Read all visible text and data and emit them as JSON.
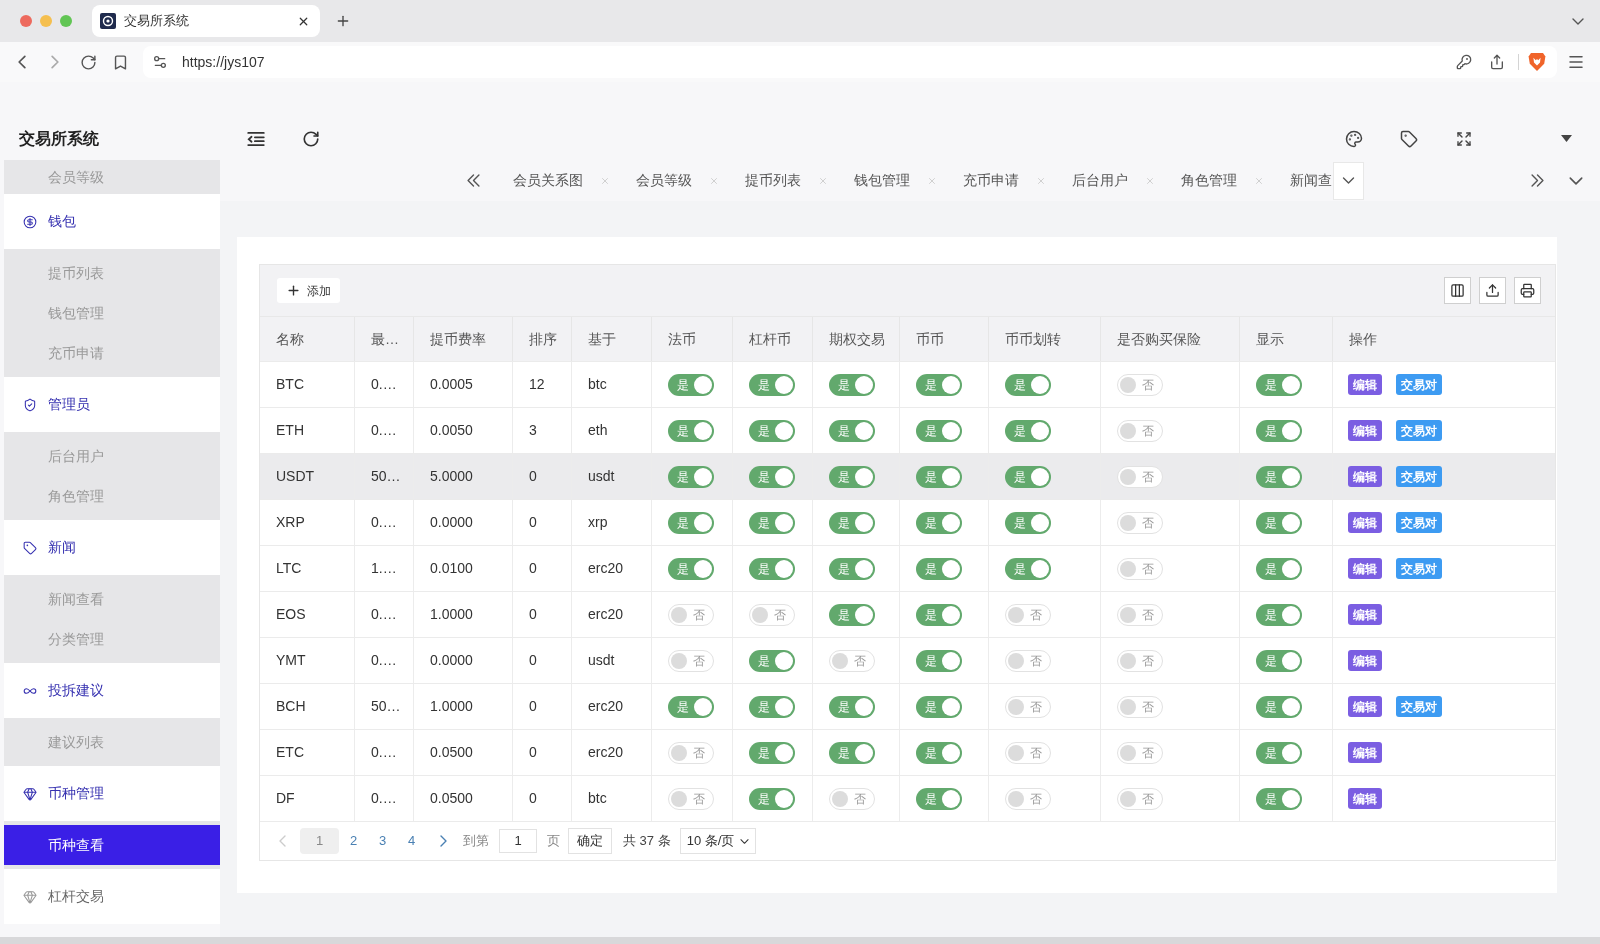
{
  "browser": {
    "tab_title": "交易所系统",
    "url": "https://jys107"
  },
  "app_title": "交易所系统",
  "sidebar": {
    "items": [
      {
        "kind": "item",
        "label": "会员等级",
        "selected": false
      },
      {
        "kind": "group",
        "label": "钱包",
        "expanded": true,
        "children": [
          {
            "label": "提币列表",
            "selected": false
          },
          {
            "label": "钱包管理",
            "selected": false
          },
          {
            "label": "充币申请",
            "selected": false
          }
        ]
      },
      {
        "kind": "group",
        "label": "管理员",
        "expanded": true,
        "children": [
          {
            "label": "后台用户",
            "selected": false
          },
          {
            "label": "角色管理",
            "selected": false
          }
        ]
      },
      {
        "kind": "group",
        "label": "新闻",
        "expanded": true,
        "children": [
          {
            "label": "新闻查看",
            "selected": false
          },
          {
            "label": "分类管理",
            "selected": false
          }
        ]
      },
      {
        "kind": "group",
        "label": "投拆建议",
        "expanded": true,
        "children": [
          {
            "label": "建议列表",
            "selected": false
          }
        ]
      },
      {
        "kind": "group",
        "label": "币种管理",
        "expanded": true,
        "children": [
          {
            "label": "币种查看",
            "selected": true
          }
        ]
      },
      {
        "kind": "group",
        "label": "杠杆交易",
        "expanded": false
      }
    ]
  },
  "tabs": [
    {
      "label": "会员关系图",
      "selected": false
    },
    {
      "label": "会员等级",
      "selected": false
    },
    {
      "label": "提币列表",
      "selected": false
    },
    {
      "label": "钱包管理",
      "selected": false
    },
    {
      "label": "充币申请",
      "selected": false
    },
    {
      "label": "后台用户",
      "selected": false
    },
    {
      "label": "角色管理",
      "selected": false
    },
    {
      "label": "新闻查",
      "selected": false
    }
  ],
  "toolbar": {
    "add_button": "添加"
  },
  "table": {
    "columns": [
      "名称",
      "最…",
      "提币费率",
      "排序",
      "基于",
      "法币",
      "杠杆币",
      "期权交易",
      "币币",
      "币币划转",
      "是否购买保险",
      "显示",
      "操作"
    ],
    "rows": [
      {
        "highlighted": false,
        "cells": [
          "BTC",
          "0.…",
          "0.0005",
          "12",
          "btc"
        ],
        "switches": [
          {
            "on": true,
            "label": "是"
          },
          {
            "on": true,
            "label": "是"
          },
          {
            "on": true,
            "label": "是"
          },
          {
            "on": true,
            "label": "是"
          },
          {
            "on": true,
            "label": "是"
          },
          {
            "on": false,
            "label": "否"
          },
          {
            "on": true,
            "label": "是"
          }
        ],
        "actions": [
          {
            "kind": "edit",
            "label": "编辑"
          },
          {
            "kind": "pair",
            "label": "交易对"
          }
        ]
      },
      {
        "highlighted": false,
        "cells": [
          "ETH",
          "0.…",
          "0.0050",
          "3",
          "eth"
        ],
        "switches": [
          {
            "on": true,
            "label": "是"
          },
          {
            "on": true,
            "label": "是"
          },
          {
            "on": true,
            "label": "是"
          },
          {
            "on": true,
            "label": "是"
          },
          {
            "on": true,
            "label": "是"
          },
          {
            "on": false,
            "label": "否"
          },
          {
            "on": true,
            "label": "是"
          }
        ],
        "actions": [
          {
            "kind": "edit",
            "label": "编辑"
          },
          {
            "kind": "pair",
            "label": "交易对"
          }
        ]
      },
      {
        "highlighted": true,
        "cells": [
          "USDT",
          "50…",
          "5.0000",
          "0",
          "usdt"
        ],
        "switches": [
          {
            "on": true,
            "label": "是"
          },
          {
            "on": true,
            "label": "是"
          },
          {
            "on": true,
            "label": "是"
          },
          {
            "on": true,
            "label": "是"
          },
          {
            "on": true,
            "label": "是"
          },
          {
            "on": false,
            "label": "否"
          },
          {
            "on": true,
            "label": "是"
          }
        ],
        "actions": [
          {
            "kind": "edit",
            "label": "编辑"
          },
          {
            "kind": "pair",
            "label": "交易对"
          }
        ]
      },
      {
        "highlighted": false,
        "cells": [
          "XRP",
          "0.…",
          "0.0000",
          "0",
          "xrp"
        ],
        "switches": [
          {
            "on": true,
            "label": "是"
          },
          {
            "on": true,
            "label": "是"
          },
          {
            "on": true,
            "label": "是"
          },
          {
            "on": true,
            "label": "是"
          },
          {
            "on": true,
            "label": "是"
          },
          {
            "on": false,
            "label": "否"
          },
          {
            "on": true,
            "label": "是"
          }
        ],
        "actions": [
          {
            "kind": "edit",
            "label": "编辑"
          },
          {
            "kind": "pair",
            "label": "交易对"
          }
        ]
      },
      {
        "highlighted": false,
        "cells": [
          "LTC",
          "1.…",
          "0.0100",
          "0",
          "erc20"
        ],
        "switches": [
          {
            "on": true,
            "label": "是"
          },
          {
            "on": true,
            "label": "是"
          },
          {
            "on": true,
            "label": "是"
          },
          {
            "on": true,
            "label": "是"
          },
          {
            "on": true,
            "label": "是"
          },
          {
            "on": false,
            "label": "否"
          },
          {
            "on": true,
            "label": "是"
          }
        ],
        "actions": [
          {
            "kind": "edit",
            "label": "编辑"
          },
          {
            "kind": "pair",
            "label": "交易对"
          }
        ]
      },
      {
        "highlighted": false,
        "cells": [
          "EOS",
          "0.…",
          "1.0000",
          "0",
          "erc20"
        ],
        "switches": [
          {
            "on": false,
            "label": "否"
          },
          {
            "on": false,
            "label": "否"
          },
          {
            "on": true,
            "label": "是"
          },
          {
            "on": true,
            "label": "是"
          },
          {
            "on": false,
            "label": "否"
          },
          {
            "on": false,
            "label": "否"
          },
          {
            "on": true,
            "label": "是"
          }
        ],
        "actions": [
          {
            "kind": "edit",
            "label": "编辑"
          }
        ]
      },
      {
        "highlighted": false,
        "cells": [
          "YMT",
          "0.…",
          "0.0000",
          "0",
          "usdt"
        ],
        "switches": [
          {
            "on": false,
            "label": "否"
          },
          {
            "on": true,
            "label": "是"
          },
          {
            "on": false,
            "label": "否"
          },
          {
            "on": true,
            "label": "是"
          },
          {
            "on": false,
            "label": "否"
          },
          {
            "on": false,
            "label": "否"
          },
          {
            "on": true,
            "label": "是"
          }
        ],
        "actions": [
          {
            "kind": "edit",
            "label": "编辑"
          }
        ]
      },
      {
        "highlighted": false,
        "cells": [
          "BCH",
          "50…",
          "1.0000",
          "0",
          "erc20"
        ],
        "switches": [
          {
            "on": true,
            "label": "是"
          },
          {
            "on": true,
            "label": "是"
          },
          {
            "on": true,
            "label": "是"
          },
          {
            "on": true,
            "label": "是"
          },
          {
            "on": false,
            "label": "否"
          },
          {
            "on": false,
            "label": "否"
          },
          {
            "on": true,
            "label": "是"
          }
        ],
        "actions": [
          {
            "kind": "edit",
            "label": "编辑"
          },
          {
            "kind": "pair",
            "label": "交易对"
          }
        ]
      },
      {
        "highlighted": false,
        "cells": [
          "ETC",
          "0.…",
          "0.0500",
          "0",
          "erc20"
        ],
        "switches": [
          {
            "on": false,
            "label": "否"
          },
          {
            "on": true,
            "label": "是"
          },
          {
            "on": true,
            "label": "是"
          },
          {
            "on": true,
            "label": "是"
          },
          {
            "on": false,
            "label": "否"
          },
          {
            "on": false,
            "label": "否"
          },
          {
            "on": true,
            "label": "是"
          }
        ],
        "actions": [
          {
            "kind": "edit",
            "label": "编辑"
          }
        ]
      },
      {
        "highlighted": false,
        "cells": [
          "DF",
          "0.…",
          "0.0500",
          "0",
          "btc"
        ],
        "switches": [
          {
            "on": false,
            "label": "否"
          },
          {
            "on": true,
            "label": "是"
          },
          {
            "on": false,
            "label": "否"
          },
          {
            "on": true,
            "label": "是"
          },
          {
            "on": false,
            "label": "否"
          },
          {
            "on": false,
            "label": "否"
          },
          {
            "on": true,
            "label": "是"
          }
        ],
        "actions": [
          {
            "kind": "edit",
            "label": "编辑"
          }
        ]
      }
    ]
  },
  "pagination": {
    "pages": [
      {
        "label": "1",
        "selected": true
      },
      {
        "label": "2",
        "selected": false
      },
      {
        "label": "3",
        "selected": false
      },
      {
        "label": "4",
        "selected": false
      }
    ],
    "goto_label": "到第",
    "goto_value": "1",
    "page_unit": "页",
    "confirm_button": "确定",
    "total": "共 37 条",
    "page_size": "10 条/页"
  }
}
